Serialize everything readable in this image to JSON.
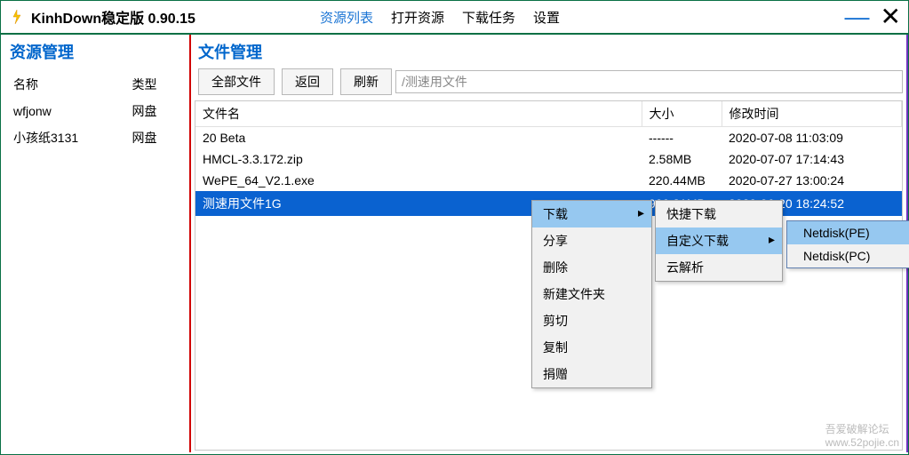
{
  "title": "KinhDown稳定版 0.90.15",
  "nav": {
    "items": [
      {
        "label": "资源列表",
        "active": true
      },
      {
        "label": "打开资源",
        "active": false
      },
      {
        "label": "下载任务",
        "active": false
      },
      {
        "label": "设置",
        "active": false
      }
    ]
  },
  "sidebar": {
    "title": "资源管理",
    "headers": {
      "name": "名称",
      "type": "类型"
    },
    "rows": [
      {
        "name": "wfjonw",
        "type": "网盘"
      },
      {
        "name": "小孩纸3131",
        "type": "网盘"
      }
    ]
  },
  "content": {
    "title": "文件管理",
    "toolbar": {
      "all_files": "全部文件",
      "back": "返回",
      "refresh": "刷新"
    },
    "path": "/测速用文件",
    "headers": {
      "name": "文件名",
      "size": "大小",
      "mtime": "修改时间"
    },
    "files": [
      {
        "name": "20 Beta",
        "size": "------",
        "mtime": "2020-07-08 11:03:09",
        "selected": false
      },
      {
        "name": "HMCL-3.3.172.zip",
        "size": "2.58MB",
        "mtime": "2020-07-07 17:14:43",
        "selected": false
      },
      {
        "name": "WePE_64_V2.1.exe",
        "size": "220.44MB",
        "mtime": "2020-07-27 13:00:24",
        "selected": false
      },
      {
        "name": "测速用文件1G",
        "size": "999.31MB",
        "mtime": "2020-06-20 18:24:52",
        "selected": true
      }
    ]
  },
  "context_menu": {
    "level1": [
      {
        "label": "下载",
        "submenu": true,
        "highlighted": true
      },
      {
        "label": "分享"
      },
      {
        "label": "删除"
      },
      {
        "label": "新建文件夹"
      },
      {
        "label": "剪切"
      },
      {
        "label": "复制"
      },
      {
        "label": "捐赠"
      }
    ],
    "level2": [
      {
        "label": "快捷下载"
      },
      {
        "label": "自定义下载",
        "submenu": true,
        "highlighted": true
      },
      {
        "label": "云解析"
      }
    ],
    "level3": [
      {
        "label": "Netdisk(PE)",
        "highlighted": true
      },
      {
        "label": "Netdisk(PC)"
      }
    ]
  },
  "watermark": {
    "line1": "吾爱破解论坛",
    "line2": "www.52pojie.cn"
  }
}
